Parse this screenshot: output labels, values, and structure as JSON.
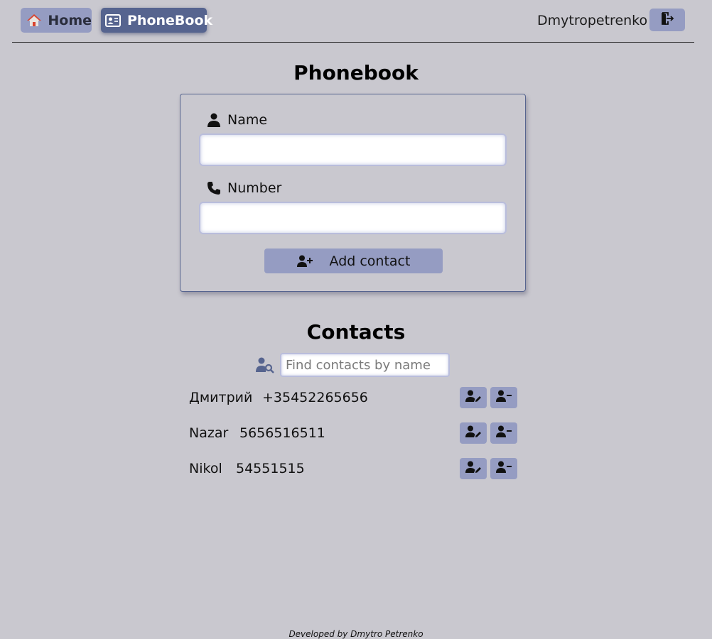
{
  "nav": {
    "home_label": "Home",
    "phonebook_label": "PhoneBook",
    "user_name": "Dmytropetrenko",
    "home_icon": "house-icon",
    "phonebook_icon": "contact-card-icon",
    "logout_icon": "logout-icon"
  },
  "form": {
    "title": "Phonebook",
    "name_label": "Name",
    "name_value": "",
    "number_label": "Number",
    "number_value": "",
    "add_button_label": "Add contact"
  },
  "contacts": {
    "title": "Contacts",
    "search_placeholder": "Find contacts by name",
    "search_value": "",
    "items": [
      {
        "name": "Дмитрий",
        "number": "+35452265656"
      },
      {
        "name": "Nazar",
        "number": "5656516511"
      },
      {
        "name": "Nikol",
        "number": "54551515"
      }
    ]
  },
  "footer": {
    "text": "Developed by Dmytro Petrenko"
  },
  "colors": {
    "background": "#c9c8cf",
    "button": "#959cc2",
    "active_nav": "#56648f",
    "card_border": "#56648f"
  }
}
